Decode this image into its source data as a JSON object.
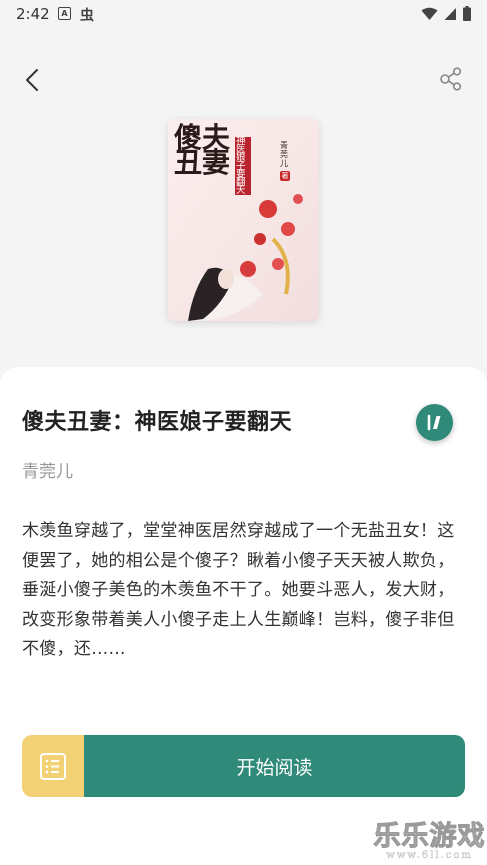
{
  "status_bar": {
    "time": "2:42",
    "icon_a": "A",
    "icon_bug": "虫"
  },
  "nav": {
    "back_icon": "chevron-left-icon",
    "share_icon": "share-icon"
  },
  "book": {
    "title": "傻夫丑妻：神医娘子要翻天",
    "author": "青莞儿",
    "description": "木羡鱼穿越了，堂堂神医居然穿越成了一个无盐丑女！这便罢了，她的相公是个傻子？瞅着小傻子天天被人欺负，垂涎小傻子美色的木羡鱼不干了。她要斗恶人，发大财，改变形象带着美人小傻子走上人生巅峰！岂料，傻子非但不傻，还……",
    "cover": {
      "title_big": "傻夫丑妻",
      "subtitle": "神医娘子要翻天",
      "author": "青莞儿",
      "author_suffix": "著"
    }
  },
  "actions": {
    "read_label": "开始阅读",
    "toc_icon": "table-of-contents-icon",
    "fab_icon": "note-icon"
  },
  "watermark": {
    "main": "乐乐游戏",
    "sub": "www.6ll.com"
  },
  "colors": {
    "accent": "#2f8a79",
    "toc_bg": "#f3d276",
    "background": "#f4f4f4"
  }
}
